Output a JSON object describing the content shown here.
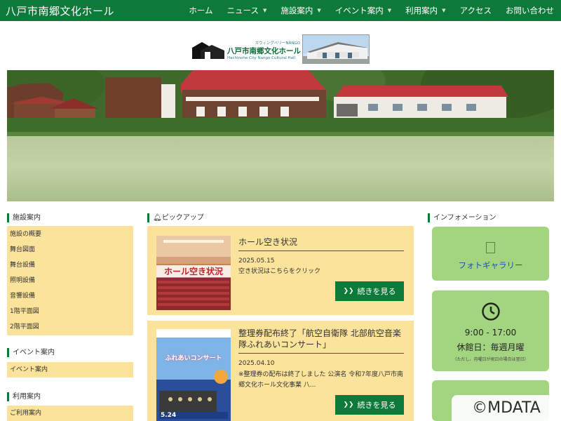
{
  "header": {
    "site_title": "八戸市南郷文化ホール",
    "nav": [
      {
        "label": "ホーム",
        "has_dropdown": false
      },
      {
        "label": "ニュース",
        "has_dropdown": true
      },
      {
        "label": "施設案内",
        "has_dropdown": true
      },
      {
        "label": "イベント案内",
        "has_dropdown": true
      },
      {
        "label": "利用案内",
        "has_dropdown": true
      },
      {
        "label": "アクセス",
        "has_dropdown": false
      },
      {
        "label": "お問い合わせ",
        "has_dropdown": false
      }
    ]
  },
  "logo": {
    "subtitle": "スウィングベリーNANGO",
    "name": "八戸市南郷文化ホール",
    "english": "Hachinohe City Nango Cultural Hall"
  },
  "sidebar": {
    "facility": {
      "heading": "施設案内",
      "links": [
        "施設の概要",
        "舞台図面",
        "舞台設備",
        "照明設備",
        "音響設備",
        "1階平面図",
        "2階平面図"
      ]
    },
    "event": {
      "heading": "イベント案内",
      "links": [
        "イベント案内"
      ]
    },
    "usage": {
      "heading": "利用案内",
      "links": [
        "ご利用案内"
      ]
    }
  },
  "pickup": {
    "heading": "ピックアップ",
    "heading_icon": "bell-icon",
    "items": [
      {
        "title": "ホール空き状況",
        "thumb_caption": "ホール空き状況",
        "date": "2025.05.15",
        "desc": "空き状況はこちらをクリック",
        "more": "続きを見る"
      },
      {
        "title": "整理券配布終了「航空自衛隊 北部航空音楽隊ふれあいコンサート」",
        "thumb_caption": "ふれあいコンサート",
        "thumb_date": "5.24",
        "date": "2025.04.10",
        "desc": "※整理券の配布は終了しました 公演名 令和7年度八戸市南郷文化ホール文化事業 八...",
        "more": "続きを見る"
      }
    ]
  },
  "info": {
    "heading": "インフォメーション",
    "gallery_label": "フォトギャラリー",
    "hours": "9:00 - 17:00",
    "closed": "休館日：毎週月曜",
    "closed_note": "（ただし、月曜日が祝日の場合は翌日）"
  },
  "watermark": "©MDATA",
  "colors": {
    "brand_green": "#0e7a3a",
    "card_yellow": "#fbe39b",
    "info_green": "#a3d581"
  }
}
